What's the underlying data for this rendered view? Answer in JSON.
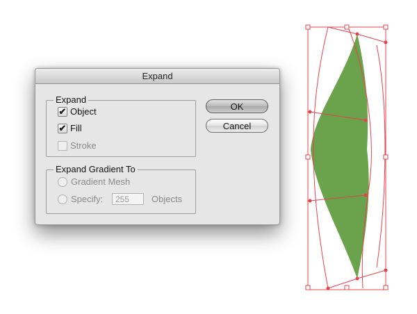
{
  "dialog": {
    "title": "Expand",
    "expand_group": {
      "legend": "Expand",
      "object": {
        "label": "Object",
        "checked": true
      },
      "fill": {
        "label": "Fill",
        "checked": true
      },
      "stroke": {
        "label": "Stroke",
        "checked": false,
        "disabled": true
      }
    },
    "gradient_group": {
      "legend": "Expand Gradient To",
      "gradient_mesh": {
        "label": "Gradient Mesh",
        "disabled": true
      },
      "specify": {
        "label": "Specify:",
        "value": "255",
        "unit": "Objects"
      }
    },
    "buttons": {
      "ok": "OK",
      "cancel": "Cancel"
    }
  },
  "artwork": {
    "fill_color": "#6ba34d",
    "stroke_color": "#e8414b"
  },
  "glyphs": {
    "check": "✔"
  }
}
